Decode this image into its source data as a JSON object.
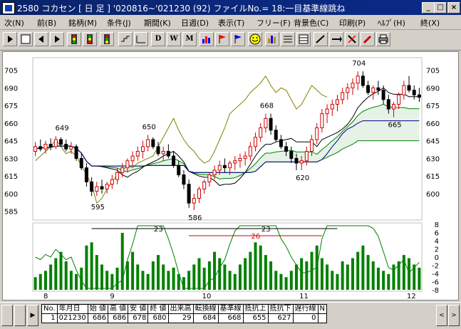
{
  "window": {
    "title": "2580 コカセン [ 日 足 ]  '020816~'021230 (92)  ファイルNo.= 18:一目基準線跳ね",
    "min_label": "_",
    "max_label": "□",
    "close_label": "×"
  },
  "menu": [
    {
      "label": "次(N)"
    },
    {
      "label": "前(B)"
    },
    {
      "label": "銘柄(M)"
    },
    {
      "label": "条件(J)"
    },
    {
      "label": "期間(K)"
    },
    {
      "label": "日週(D)"
    },
    {
      "label": "表示(T)"
    },
    {
      "label": "フリー(F)"
    },
    {
      "label": "背景色(C)"
    },
    {
      "label": "印刷(P)"
    },
    {
      "label": "ﾍﾙﾌﾟ(H)"
    },
    {
      "label": "終(X)"
    }
  ],
  "toolbar": {
    "d_label": "D",
    "w_label": "W",
    "m_label": "M"
  },
  "colors": {
    "up_candle": "#d00000",
    "down_candle": "#000000",
    "volume": "#008000",
    "base_line": "#000000",
    "conv_line": "#000080",
    "lagging_line": "#808000",
    "cloud": "#008000",
    "ma_line": "#ff0000"
  },
  "chart_data": {
    "type": "candlestick",
    "y_left_ticks": [
      "705",
      "690",
      "675",
      "660",
      "645",
      "630",
      "615",
      "600",
      "585"
    ],
    "y_right_ticks": [
      "705",
      "690",
      "675",
      "660",
      "645",
      "630",
      "615",
      "600"
    ],
    "osc_right_ticks": [
      "8",
      "6",
      "4",
      "2",
      "0",
      "-2",
      "-4",
      "-6",
      "-8"
    ],
    "month_labels": [
      "8",
      "9",
      "10",
      "11",
      "12"
    ],
    "annotations": [
      "649",
      "650",
      "595",
      "586",
      "668",
      "620",
      "704",
      "665"
    ],
    "span_labels": [
      "23",
      "23",
      "26"
    ],
    "ylim": [
      580,
      712
    ],
    "ohlc": [
      [
        636,
        644,
        632,
        640
      ],
      [
        640,
        646,
        636,
        638
      ],
      [
        638,
        645,
        634,
        642
      ],
      [
        642,
        647,
        637,
        640
      ],
      [
        640,
        649,
        638,
        646
      ],
      [
        646,
        648,
        640,
        642
      ],
      [
        642,
        646,
        636,
        638
      ],
      [
        638,
        644,
        634,
        640
      ],
      [
        640,
        642,
        628,
        630
      ],
      [
        630,
        634,
        620,
        622
      ],
      [
        622,
        626,
        606,
        610
      ],
      [
        610,
        614,
        598,
        602
      ],
      [
        602,
        610,
        598,
        606
      ],
      [
        606,
        612,
        600,
        604
      ],
      [
        604,
        610,
        600,
        608
      ],
      [
        608,
        616,
        604,
        612
      ],
      [
        612,
        622,
        608,
        618
      ],
      [
        618,
        626,
        614,
        622
      ],
      [
        622,
        630,
        618,
        628
      ],
      [
        628,
        636,
        624,
        632
      ],
      [
        632,
        640,
        628,
        636
      ],
      [
        636,
        645,
        630,
        640
      ],
      [
        640,
        650,
        636,
        646
      ],
      [
        646,
        648,
        638,
        640
      ],
      [
        640,
        644,
        632,
        634
      ],
      [
        634,
        640,
        628,
        636
      ],
      [
        636,
        642,
        630,
        632
      ],
      [
        632,
        636,
        622,
        624
      ],
      [
        624,
        628,
        614,
        616
      ],
      [
        616,
        620,
        604,
        608
      ],
      [
        608,
        612,
        588,
        592
      ],
      [
        592,
        600,
        586,
        596
      ],
      [
        596,
        606,
        592,
        604
      ],
      [
        604,
        612,
        600,
        610
      ],
      [
        610,
        618,
        606,
        616
      ],
      [
        616,
        624,
        612,
        620
      ],
      [
        620,
        628,
        616,
        624
      ],
      [
        624,
        630,
        618,
        622
      ],
      [
        622,
        628,
        616,
        626
      ],
      [
        626,
        632,
        620,
        628
      ],
      [
        628,
        634,
        622,
        630
      ],
      [
        630,
        636,
        624,
        632
      ],
      [
        632,
        644,
        628,
        640
      ],
      [
        640,
        652,
        636,
        648
      ],
      [
        648,
        660,
        644,
        656
      ],
      [
        656,
        668,
        652,
        664
      ],
      [
        664,
        668,
        650,
        654
      ],
      [
        654,
        658,
        644,
        646
      ],
      [
        646,
        650,
        638,
        640
      ],
      [
        640,
        644,
        632,
        636
      ],
      [
        636,
        640,
        626,
        630
      ],
      [
        630,
        634,
        620,
        626
      ],
      [
        626,
        632,
        620,
        628
      ],
      [
        628,
        640,
        624,
        636
      ],
      [
        636,
        650,
        632,
        646
      ],
      [
        646,
        660,
        642,
        656
      ],
      [
        656,
        672,
        652,
        668
      ],
      [
        668,
        676,
        660,
        672
      ],
      [
        672,
        680,
        666,
        676
      ],
      [
        676,
        684,
        670,
        680
      ],
      [
        680,
        690,
        676,
        686
      ],
      [
        686,
        694,
        680,
        690
      ],
      [
        690,
        698,
        684,
        694
      ],
      [
        694,
        704,
        688,
        700
      ],
      [
        700,
        704,
        690,
        692
      ],
      [
        692,
        696,
        684,
        686
      ],
      [
        686,
        692,
        680,
        690
      ],
      [
        690,
        696,
        684,
        688
      ],
      [
        688,
        692,
        676,
        680
      ],
      [
        680,
        684,
        668,
        672
      ],
      [
        672,
        678,
        665,
        676
      ],
      [
        676,
        686,
        672,
        684
      ],
      [
        684,
        696,
        680,
        692
      ],
      [
        692,
        700,
        686,
        688
      ],
      [
        688,
        692,
        680,
        684
      ],
      [
        684,
        690,
        678,
        682
      ]
    ],
    "volume": [
      4,
      5,
      6,
      8,
      10,
      12,
      9,
      6,
      5,
      7,
      14,
      15,
      11,
      8,
      6,
      5,
      7,
      18,
      9,
      12,
      8,
      6,
      5,
      9,
      11,
      8,
      6,
      7,
      5,
      4,
      6,
      8,
      10,
      7,
      9,
      12,
      10,
      8,
      6,
      5,
      8,
      10,
      12,
      15,
      14,
      11,
      9,
      6,
      5,
      4,
      6,
      8,
      10,
      9,
      12,
      14,
      10,
      8,
      6,
      5,
      9,
      8,
      10,
      12,
      14,
      11,
      9,
      7,
      6,
      5,
      8,
      9,
      11,
      10,
      8,
      7
    ]
  },
  "table": {
    "headers": [
      "No.",
      "年月日",
      "始 値",
      "高 値",
      "安 値",
      "終 値",
      "出来高",
      "転換線",
      "基準線",
      "抵抗上",
      "抵抗下",
      "遅行線",
      "N"
    ],
    "row": [
      "1",
      "021230",
      "686",
      "686",
      "678",
      "680",
      "29",
      "684",
      "668",
      "655",
      "627",
      "0",
      ""
    ]
  }
}
